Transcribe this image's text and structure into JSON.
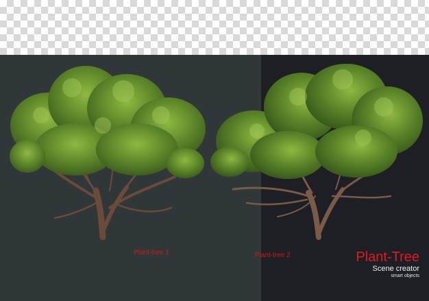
{
  "labels": {
    "tree_1": "Plant-tree 1",
    "tree_2": "Plant-tree 2"
  },
  "brand": {
    "title": "Plant-Tree",
    "subtitle": "Scene creator",
    "tagline": "smart objects"
  },
  "colors": {
    "checker_light": "#ffffff",
    "checker_dark": "#d9d9d9",
    "panel_left": "#2f3739",
    "panel_right": "#1d1f24",
    "label_red": "#d3171c",
    "brand_red": "#e11b22",
    "foliage_dark": "#3f5e1f",
    "foliage_mid": "#5f8a2a",
    "foliage_light": "#8fb842",
    "trunk": "#6b4a3a"
  }
}
